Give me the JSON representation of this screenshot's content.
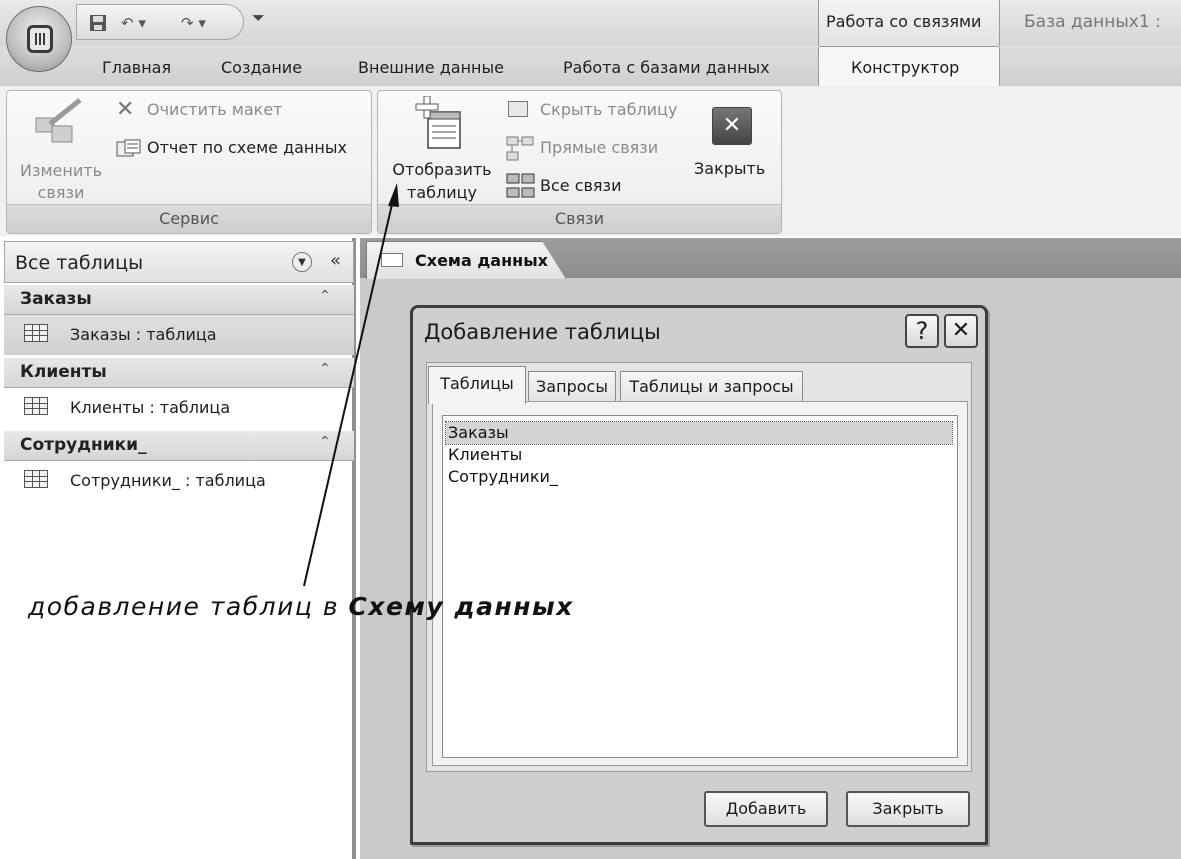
{
  "window": {
    "context_group_title": "Работа со связями",
    "db_title": "База данных1 :"
  },
  "ribbon": {
    "tabs": [
      "Главная",
      "Создание",
      "Внешние данные",
      "Работа с базами данных",
      "Конструктор"
    ],
    "service_group": {
      "label": "Сервис",
      "edit_links": "Изменить связи",
      "edit_links_line1": "Изменить",
      "edit_links_line2": "связи",
      "clear_layout": "Очистить макет",
      "report": "Отчет по схеме данных"
    },
    "links_group": {
      "label": "Связи",
      "show_table_line1": "Отобразить",
      "show_table_line2": "таблицу",
      "hide_table": "Скрыть таблицу",
      "direct_links": "Прямые связи",
      "all_links": "Все связи",
      "close": "Закрыть"
    }
  },
  "nav": {
    "title": "Все таблицы",
    "groups": [
      {
        "header": "Заказы",
        "item": "Заказы : таблица"
      },
      {
        "header": "Клиенты",
        "item": "Клиенты : таблица"
      },
      {
        "header": "Сотрудники_",
        "item": "Сотрудники_ : таблица"
      }
    ]
  },
  "document": {
    "tab_title": "Схема данных"
  },
  "dialog": {
    "title": "Добавление таблицы",
    "help": "?",
    "close_x": "✕",
    "tabs": [
      "Таблицы",
      "Запросы",
      "Таблицы и запросы"
    ],
    "items": [
      "Заказы",
      "Клиенты",
      "Сотрудники_"
    ],
    "add_button": "Добавить",
    "close_button": "Закрыть"
  },
  "annotation": {
    "text_plain": "добавление таблиц в ",
    "text_bold": "Схему данных"
  }
}
